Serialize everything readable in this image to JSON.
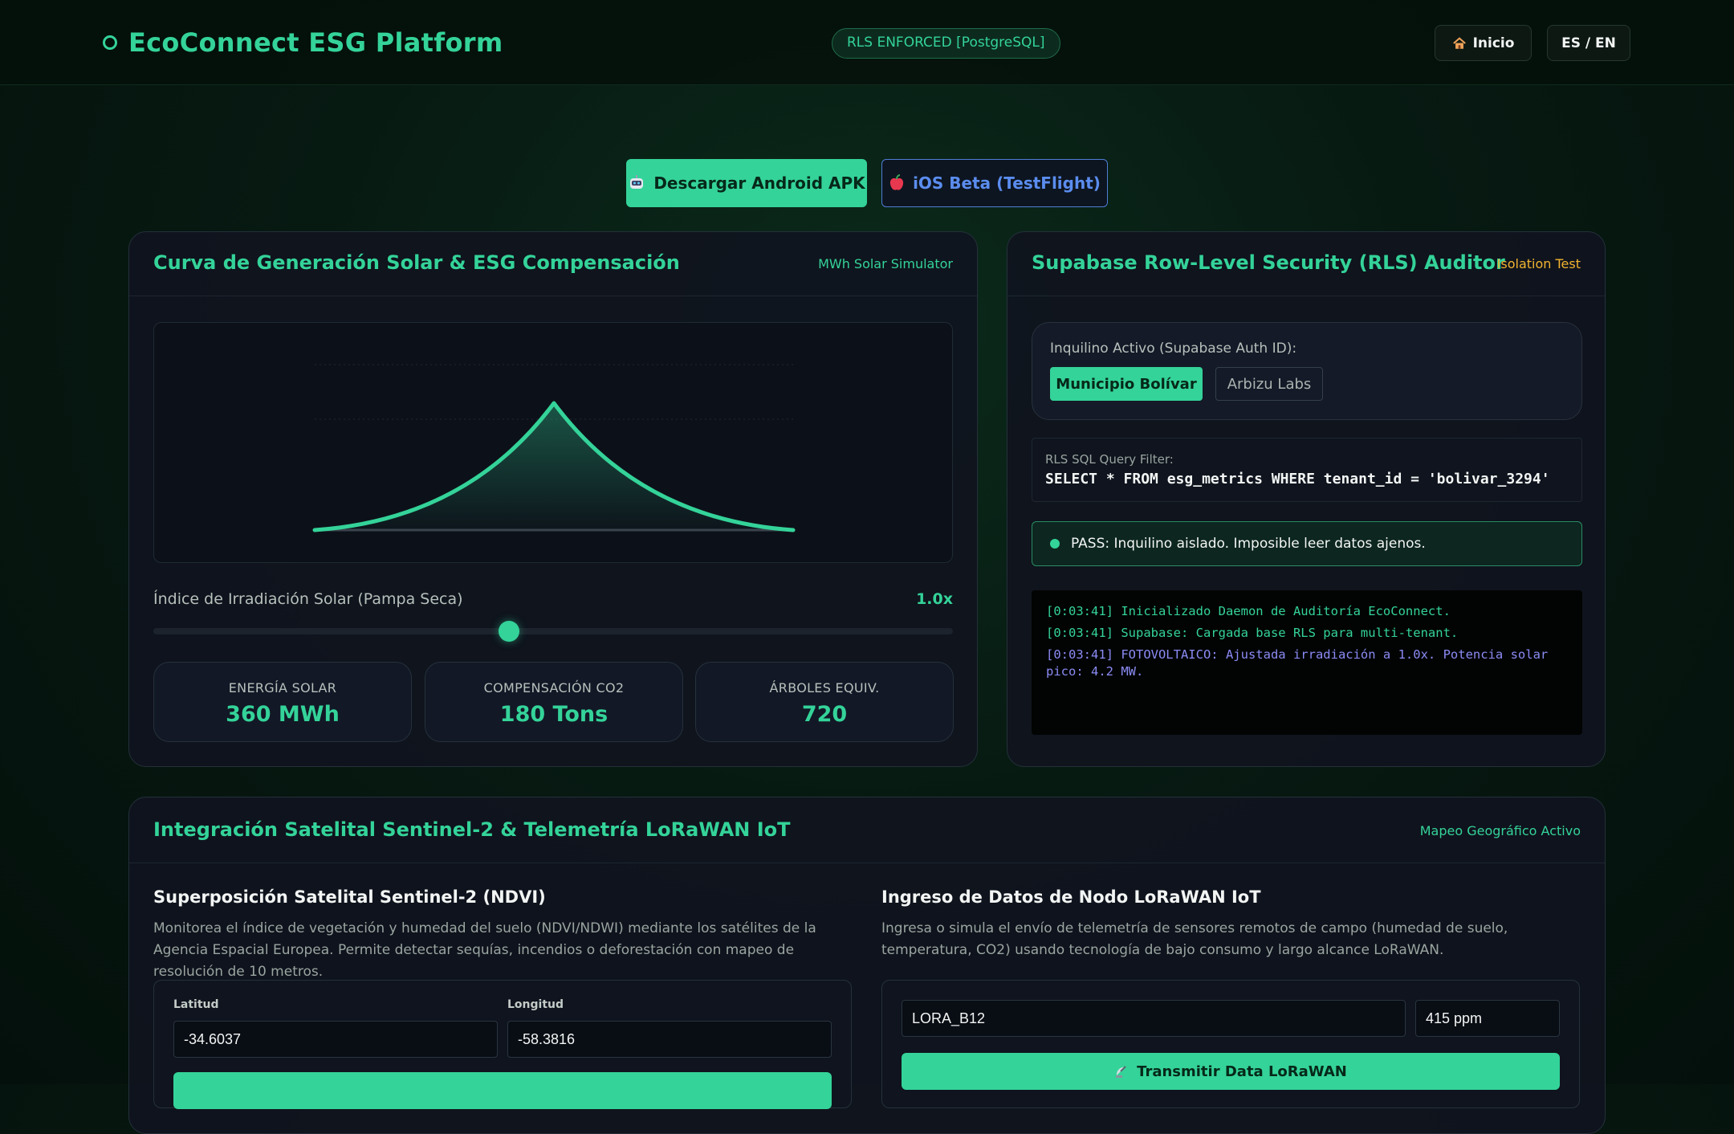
{
  "header": {
    "title": "EcoConnect ESG Platform",
    "rls_badge": "RLS ENFORCED [PostgreSQL]",
    "home_label": "Inicio",
    "lang_label": "ES / EN"
  },
  "downloads": {
    "android_label": "Descargar Android APK",
    "ios_label": "iOS Beta (TestFlight)"
  },
  "solar": {
    "title": "Curva de Generación Solar & ESG Compensación",
    "tag": "MWh Solar Simulator",
    "slider_label": "Índice de Irradiación Solar (Pampa Seca)",
    "slider_value": "1.0x",
    "slider_level": 0.445,
    "stats": [
      {
        "label": "ENERGÍA SOLAR",
        "value": "360 MWh"
      },
      {
        "label": "COMPENSACIÓN CO2",
        "value": "180 Tons"
      },
      {
        "label": "ÁRBOLES EQUIV.",
        "value": "720"
      }
    ]
  },
  "rls": {
    "title": "Supabase Row-Level Security (RLS) Auditor",
    "tag": "Isolation Test",
    "tenant_label": "Inquilino Activo (Supabase Auth ID):",
    "tenants": [
      "Municipio Bolívar",
      "Arbizu Labs"
    ],
    "sql_label": "RLS SQL Query Filter:",
    "sql_query": "SELECT * FROM esg_metrics WHERE tenant_id = 'bolivar_3294'",
    "pass_text": "PASS: Inquilino aislado. Imposible leer datos ajenos.",
    "logs": [
      "[0:03:41] Inicializado Daemon de Auditoría EcoConnect.",
      "[0:03:41] Supabase: Cargada base RLS para multi-tenant.",
      "[0:03:41] FOTOVOLTAICO: Ajustada irradiación a 1.0x. Potencia solar pico: 4.2 MW."
    ]
  },
  "satellite": {
    "title": "Integración Satelital Sentinel-2 & Telemetría LoRaWAN IoT",
    "tag": "Mapeo Geográfico Activo",
    "ndvi_title": "Superposición Satelital Sentinel-2 (NDVI)",
    "ndvi_desc": "Monitorea el índice de vegetación y humedad del suelo (NDVI/NDWI) mediante los satélites de la Agencia Espacial Europea. Permite detectar sequías, incendios o deforestación con mapeo de resolución de 10 metros.",
    "lat_label": "Latitud",
    "lat_value": "-34.6037",
    "lon_label": "Longitud",
    "lon_value": "-58.3816",
    "lora_title": "Ingreso de Datos de Nodo LoRaWAN IoT",
    "lora_desc": "Ingresa o simula el envío de telemetría de sensores remotos de campo (humedad de suelo, temperatura, CO2) usando tecnología de bajo consumo y largo alcance LoRaWAN.",
    "node_value": "LORA_B12",
    "ppm_value": "415 ppm",
    "transmit_label": "Transmitir Data LoRaWAN"
  },
  "icons": {
    "brand": "circle-icon",
    "home": "house-icon",
    "android": "robot-icon",
    "ios": "apple-icon",
    "transmit": "satellite-antenna-icon"
  },
  "colors": {
    "accent": "#34d399",
    "amber": "#f2b431",
    "ios_blue": "#5b8def",
    "log_purple": "#8b8bf5"
  }
}
